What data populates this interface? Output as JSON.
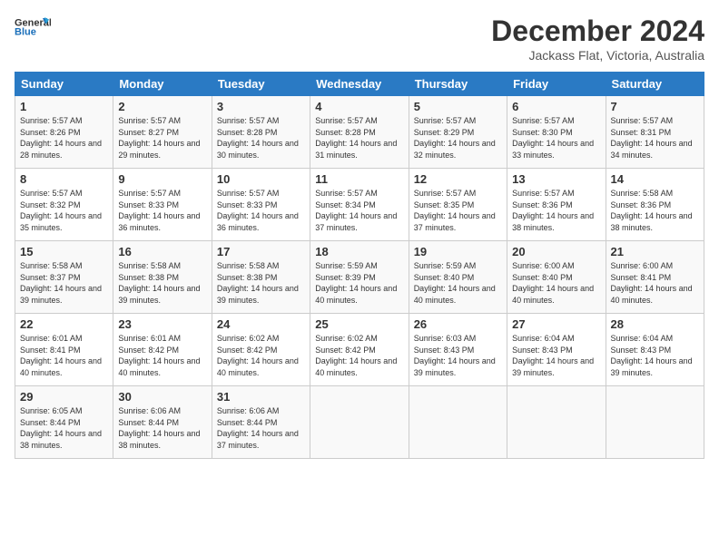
{
  "header": {
    "logo_line1": "General",
    "logo_line2": "Blue",
    "month": "December 2024",
    "location": "Jackass Flat, Victoria, Australia"
  },
  "weekdays": [
    "Sunday",
    "Monday",
    "Tuesday",
    "Wednesday",
    "Thursday",
    "Friday",
    "Saturday"
  ],
  "weeks": [
    [
      {
        "day": "1",
        "sunrise": "5:57 AM",
        "sunset": "8:26 PM",
        "daylight": "14 hours and 28 minutes."
      },
      {
        "day": "2",
        "sunrise": "5:57 AM",
        "sunset": "8:27 PM",
        "daylight": "14 hours and 29 minutes."
      },
      {
        "day": "3",
        "sunrise": "5:57 AM",
        "sunset": "8:28 PM",
        "daylight": "14 hours and 30 minutes."
      },
      {
        "day": "4",
        "sunrise": "5:57 AM",
        "sunset": "8:28 PM",
        "daylight": "14 hours and 31 minutes."
      },
      {
        "day": "5",
        "sunrise": "5:57 AM",
        "sunset": "8:29 PM",
        "daylight": "14 hours and 32 minutes."
      },
      {
        "day": "6",
        "sunrise": "5:57 AM",
        "sunset": "8:30 PM",
        "daylight": "14 hours and 33 minutes."
      },
      {
        "day": "7",
        "sunrise": "5:57 AM",
        "sunset": "8:31 PM",
        "daylight": "14 hours and 34 minutes."
      }
    ],
    [
      {
        "day": "8",
        "sunrise": "5:57 AM",
        "sunset": "8:32 PM",
        "daylight": "14 hours and 35 minutes."
      },
      {
        "day": "9",
        "sunrise": "5:57 AM",
        "sunset": "8:33 PM",
        "daylight": "14 hours and 36 minutes."
      },
      {
        "day": "10",
        "sunrise": "5:57 AM",
        "sunset": "8:33 PM",
        "daylight": "14 hours and 36 minutes."
      },
      {
        "day": "11",
        "sunrise": "5:57 AM",
        "sunset": "8:34 PM",
        "daylight": "14 hours and 37 minutes."
      },
      {
        "day": "12",
        "sunrise": "5:57 AM",
        "sunset": "8:35 PM",
        "daylight": "14 hours and 37 minutes."
      },
      {
        "day": "13",
        "sunrise": "5:57 AM",
        "sunset": "8:36 PM",
        "daylight": "14 hours and 38 minutes."
      },
      {
        "day": "14",
        "sunrise": "5:58 AM",
        "sunset": "8:36 PM",
        "daylight": "14 hours and 38 minutes."
      }
    ],
    [
      {
        "day": "15",
        "sunrise": "5:58 AM",
        "sunset": "8:37 PM",
        "daylight": "14 hours and 39 minutes."
      },
      {
        "day": "16",
        "sunrise": "5:58 AM",
        "sunset": "8:38 PM",
        "daylight": "14 hours and 39 minutes."
      },
      {
        "day": "17",
        "sunrise": "5:58 AM",
        "sunset": "8:38 PM",
        "daylight": "14 hours and 39 minutes."
      },
      {
        "day": "18",
        "sunrise": "5:59 AM",
        "sunset": "8:39 PM",
        "daylight": "14 hours and 40 minutes."
      },
      {
        "day": "19",
        "sunrise": "5:59 AM",
        "sunset": "8:40 PM",
        "daylight": "14 hours and 40 minutes."
      },
      {
        "day": "20",
        "sunrise": "6:00 AM",
        "sunset": "8:40 PM",
        "daylight": "14 hours and 40 minutes."
      },
      {
        "day": "21",
        "sunrise": "6:00 AM",
        "sunset": "8:41 PM",
        "daylight": "14 hours and 40 minutes."
      }
    ],
    [
      {
        "day": "22",
        "sunrise": "6:01 AM",
        "sunset": "8:41 PM",
        "daylight": "14 hours and 40 minutes."
      },
      {
        "day": "23",
        "sunrise": "6:01 AM",
        "sunset": "8:42 PM",
        "daylight": "14 hours and 40 minutes."
      },
      {
        "day": "24",
        "sunrise": "6:02 AM",
        "sunset": "8:42 PM",
        "daylight": "14 hours and 40 minutes."
      },
      {
        "day": "25",
        "sunrise": "6:02 AM",
        "sunset": "8:42 PM",
        "daylight": "14 hours and 40 minutes."
      },
      {
        "day": "26",
        "sunrise": "6:03 AM",
        "sunset": "8:43 PM",
        "daylight": "14 hours and 39 minutes."
      },
      {
        "day": "27",
        "sunrise": "6:04 AM",
        "sunset": "8:43 PM",
        "daylight": "14 hours and 39 minutes."
      },
      {
        "day": "28",
        "sunrise": "6:04 AM",
        "sunset": "8:43 PM",
        "daylight": "14 hours and 39 minutes."
      }
    ],
    [
      {
        "day": "29",
        "sunrise": "6:05 AM",
        "sunset": "8:44 PM",
        "daylight": "14 hours and 38 minutes."
      },
      {
        "day": "30",
        "sunrise": "6:06 AM",
        "sunset": "8:44 PM",
        "daylight": "14 hours and 38 minutes."
      },
      {
        "day": "31",
        "sunrise": "6:06 AM",
        "sunset": "8:44 PM",
        "daylight": "14 hours and 37 minutes."
      },
      null,
      null,
      null,
      null
    ]
  ]
}
